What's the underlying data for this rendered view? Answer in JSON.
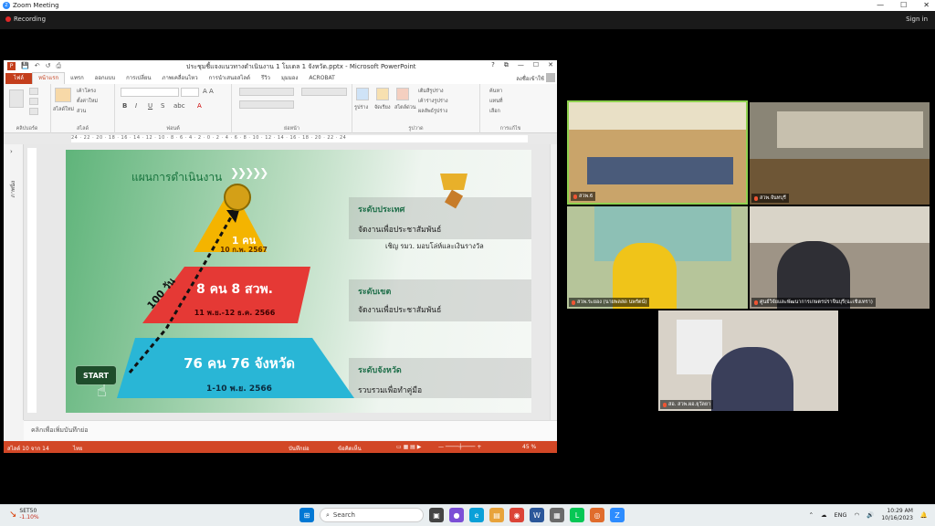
{
  "zoom": {
    "title": "Zoom Meeting",
    "recording_label": "Recording",
    "signin_label": "Sign in",
    "window_controls": [
      "—",
      "☐",
      "✕"
    ]
  },
  "ppt": {
    "doc_title": "ประชุมชี้แจงแนวทางดำเนินงาน 1 โมเดล 1 จังหวัด.pptx - Microsoft PowerPoint",
    "qat": [
      "💾",
      "↶",
      "↺",
      "⎙"
    ],
    "window_controls": [
      "?",
      "⧉",
      "—",
      "☐",
      "✕"
    ],
    "tabs": [
      "ไฟล์",
      "หน้าแรก",
      "แทรก",
      "ออกแบบ",
      "การเปลี่ยน",
      "ภาพเคลื่อนไหว",
      "การนำเสนอสไลด์",
      "รีวิว",
      "มุมมอง",
      "ACROBAT"
    ],
    "active_tab": "หน้าแรก",
    "user": "ลงชื่อเข้าใช้",
    "ribbon_groups": [
      "คลิปบอร์ด",
      "สไลด์",
      "ฟอนต์",
      "ย่อหน้า",
      "รูปวาด",
      "การแก้ไข"
    ],
    "ribbon_items": {
      "new_slide": "สไลด์ใหม่",
      "layout": "เค้าโครง",
      "reset": "ตั้งค่าใหม่",
      "section": "ส่วน",
      "shape": "รูปร่าง",
      "arrange": "จัดเรียง",
      "quick_style": "สไตล์ด่วน",
      "fill": "เติมสีรูปร่าง",
      "outline": "เค้าร่างรูปร่าง",
      "effect": "ผลลัพธ์รูปร่าง",
      "find": "ค้นหา",
      "replace": "แทนที่",
      "select": "เลือก"
    },
    "ruler_text": "24 · 22 · 20 · 18 · 16 · 14 · 12 · 10 · 8 · 6 · 4 · 2 · 0 · 2 · 4 · 6 · 8 · 10 · 12 · 14 · 16 · 18 · 20 · 22 · 24",
    "side_label": "ภาพนิ่ง",
    "notes_placeholder": "คลิกเพื่อเพิ่มบันทึกย่อ",
    "status": {
      "slide_info": "สไลด์ 10 จาก 14",
      "lang": "ไทย",
      "notes_btn": "บันทึกย่อ",
      "comments_btn": "ข้อคิดเห็น",
      "zoom_level": "45 %"
    }
  },
  "slide": {
    "title": "แผนการดำเนินงาน",
    "chevrons": "❯❯❯❯❯",
    "tiers": [
      {
        "main": "1 คน",
        "sub": "10 ก.พ. 2567",
        "color": "#f4b400"
      },
      {
        "main": "8 คน 8 สวพ.",
        "sub": "11 พ.ย.-12 ธ.ค. 2566",
        "color": "#e53935"
      },
      {
        "main": "76 คน 76 จังหวัด",
        "sub": "1-10 พ.ย. 2566",
        "color": "#29b6d6"
      }
    ],
    "levels": [
      {
        "head": "ระดับประเทศ",
        "sub": "จัดงานเพื่อประชาสัมพันธ์",
        "extra": "เชิญ รมว. มอบโล่ห์และเงินรางวัล"
      },
      {
        "head": "ระดับเขต",
        "sub": "จัดงานเพื่อประชาสัมพันธ์",
        "extra": ""
      },
      {
        "head": "ระดับจังหวัด",
        "sub": "รวบรวมเพื่อทำคู่มือ",
        "extra": ""
      }
    ],
    "days_label": "100 วัน",
    "start_label": "START"
  },
  "participants": [
    {
      "name": "สวพ.6",
      "bg": "#c9a46a"
    },
    {
      "name": "สวพ.จันทบุรี",
      "bg": "#8a8576"
    },
    {
      "name": "สวพ.ระยอง (นายพลสด นพรัตน์)",
      "bg": "#b6c59a"
    },
    {
      "name": "ศูนย์วิจัยและพัฒนาการเกษตรปราจีนบุรี(ฉะเชิงเทรา)",
      "bg": "#9e9486"
    },
    {
      "name": "สอ. สวพ.ผอ.ยุวัลยา",
      "bg": "#d8d2c8"
    }
  ],
  "taskbar": {
    "stock_name": "SET50",
    "stock_change": "-1.10%",
    "search_placeholder": "Search",
    "lang": "ENG",
    "time": "10:29 AM",
    "date": "10/16/2023"
  }
}
